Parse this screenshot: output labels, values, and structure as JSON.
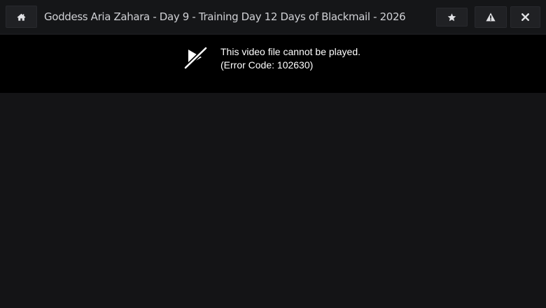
{
  "header": {
    "title": "Goddess Aria Zahara - Day 9 - Training Day 12 Days of Blackmail - 2026",
    "buttons": {
      "home_icon": "home-icon",
      "favorite_icon": "star-icon",
      "report_icon": "warning-icon",
      "close_icon": "close-icon"
    }
  },
  "player": {
    "error_icon": "video-off-icon",
    "message": "This video file cannot be played.",
    "error_code": "(Error Code: 102630)"
  },
  "colors": {
    "background": "#141416",
    "topbar": "#151618",
    "button": "#202124",
    "player": "#000000",
    "text": "#cfd0d4"
  }
}
